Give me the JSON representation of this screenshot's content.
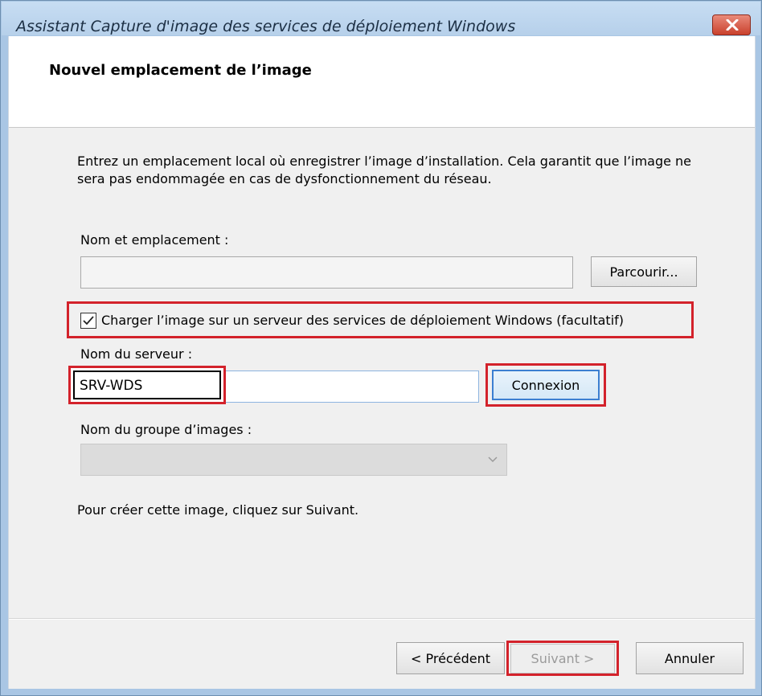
{
  "window": {
    "title": "Assistant Capture d'image des services de déploiement Windows",
    "close_icon": "close-icon"
  },
  "header": {
    "title": "Nouvel emplacement de l’image"
  },
  "body": {
    "description": "Entrez un emplacement local où enregistrer l’image d’installation. Cela garantit que l’image ne sera pas endommagée en cas de dysfonctionnement du réseau.",
    "name_location_label": "Nom et emplacement :",
    "name_location_value": "",
    "browse_label": "Parcourir...",
    "upload_checkbox_label": "Charger l’image sur un serveur des services de déploiement Windows (facultatif)",
    "upload_checked": true,
    "server_name_label": "Nom du serveur :",
    "server_name_value": "SRV-WDS",
    "connect_label": "Connexion",
    "image_group_label": "Nom du groupe d’images :",
    "image_group_value": "",
    "footer_text": "Pour créer cette image, cliquez sur Suivant."
  },
  "buttons": {
    "previous": "< Précédent",
    "next": "Suivant >",
    "cancel": "Annuler"
  },
  "colors": {
    "highlight": "#d3222b",
    "titlebar": "#b6d0ea",
    "close": "#c9412d"
  }
}
